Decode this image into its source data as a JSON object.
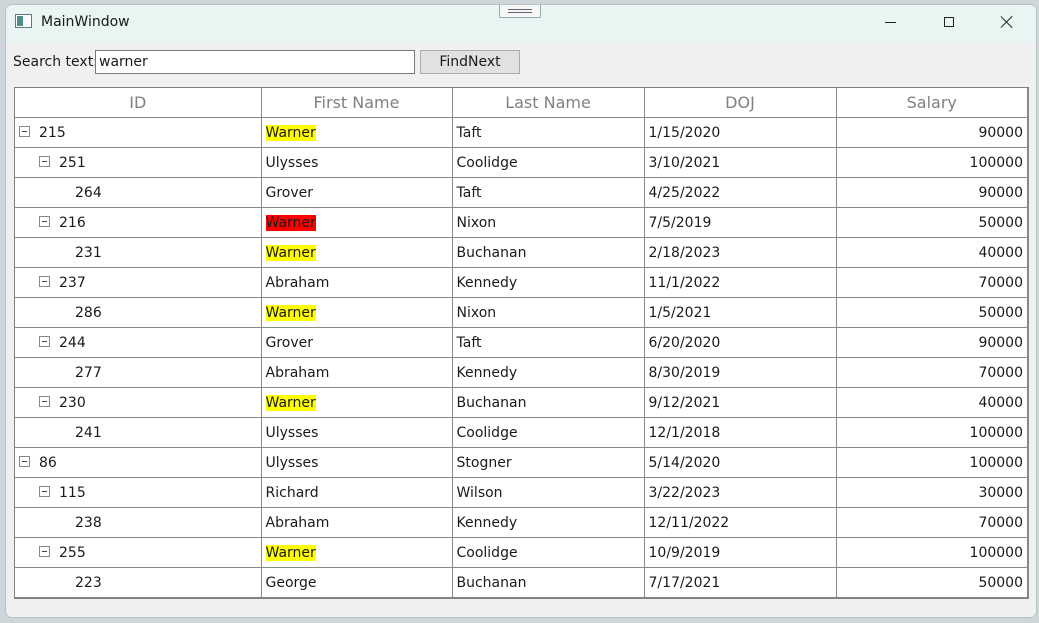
{
  "window": {
    "title": "MainWindow"
  },
  "search": {
    "label": "Search text:",
    "value": "warner",
    "button_label": "FindNext"
  },
  "grid": {
    "columns": [
      "ID",
      "First Name",
      "Last Name",
      "DOJ",
      "Salary"
    ],
    "rows": [
      {
        "level": 0,
        "expandable": true,
        "id": "215",
        "first": "Warner",
        "last": "Taft",
        "doj": "1/15/2020",
        "salary": "90000",
        "highlight": "match"
      },
      {
        "level": 1,
        "expandable": true,
        "id": "251",
        "first": "Ulysses",
        "last": "Coolidge",
        "doj": "3/10/2021",
        "salary": "100000",
        "highlight": "none"
      },
      {
        "level": 2,
        "expandable": false,
        "id": "264",
        "first": "Grover",
        "last": "Taft",
        "doj": "4/25/2022",
        "salary": "90000",
        "highlight": "none"
      },
      {
        "level": 1,
        "expandable": true,
        "id": "216",
        "first": "Warner",
        "last": "Nixon",
        "doj": "7/5/2019",
        "salary": "50000",
        "highlight": "current"
      },
      {
        "level": 2,
        "expandable": false,
        "id": "231",
        "first": "Warner",
        "last": "Buchanan",
        "doj": "2/18/2023",
        "salary": "40000",
        "highlight": "match"
      },
      {
        "level": 1,
        "expandable": true,
        "id": "237",
        "first": "Abraham",
        "last": "Kennedy",
        "doj": "11/1/2022",
        "salary": "70000",
        "highlight": "none"
      },
      {
        "level": 2,
        "expandable": false,
        "id": "286",
        "first": "Warner",
        "last": "Nixon",
        "doj": "1/5/2021",
        "salary": "50000",
        "highlight": "match"
      },
      {
        "level": 1,
        "expandable": true,
        "id": "244",
        "first": "Grover",
        "last": "Taft",
        "doj": "6/20/2020",
        "salary": "90000",
        "highlight": "none"
      },
      {
        "level": 2,
        "expandable": false,
        "id": "277",
        "first": "Abraham",
        "last": "Kennedy",
        "doj": "8/30/2019",
        "salary": "70000",
        "highlight": "none"
      },
      {
        "level": 1,
        "expandable": true,
        "id": "230",
        "first": "Warner",
        "last": "Buchanan",
        "doj": "9/12/2021",
        "salary": "40000",
        "highlight": "match"
      },
      {
        "level": 2,
        "expandable": false,
        "id": "241",
        "first": "Ulysses",
        "last": "Coolidge",
        "doj": "12/1/2018",
        "salary": "100000",
        "highlight": "none"
      },
      {
        "level": 0,
        "expandable": true,
        "id": "86",
        "first": "Ulysses",
        "last": "Stogner",
        "doj": "5/14/2020",
        "salary": "100000",
        "highlight": "none"
      },
      {
        "level": 1,
        "expandable": true,
        "id": "115",
        "first": "Richard",
        "last": "Wilson",
        "doj": "3/22/2023",
        "salary": "30000",
        "highlight": "none"
      },
      {
        "level": 2,
        "expandable": false,
        "id": "238",
        "first": "Abraham",
        "last": "Kennedy",
        "doj": "12/11/2022",
        "salary": "70000",
        "highlight": "none"
      },
      {
        "level": 1,
        "expandable": true,
        "id": "255",
        "first": "Warner",
        "last": "Coolidge",
        "doj": "10/9/2019",
        "salary": "100000",
        "highlight": "match"
      },
      {
        "level": 2,
        "expandable": false,
        "id": "223",
        "first": "George",
        "last": "Buchanan",
        "doj": "7/17/2021",
        "salary": "50000",
        "highlight": "none"
      }
    ]
  },
  "icons": {
    "app": "app-window-icon",
    "minimize": "minimize-icon",
    "maximize": "maximize-icon",
    "close": "close-icon",
    "expander": "collapse-minus-icon"
  },
  "colors": {
    "match_highlight": "#ffff00",
    "current_highlight": "#ff0000",
    "titlebar": "#e8f5f3"
  }
}
